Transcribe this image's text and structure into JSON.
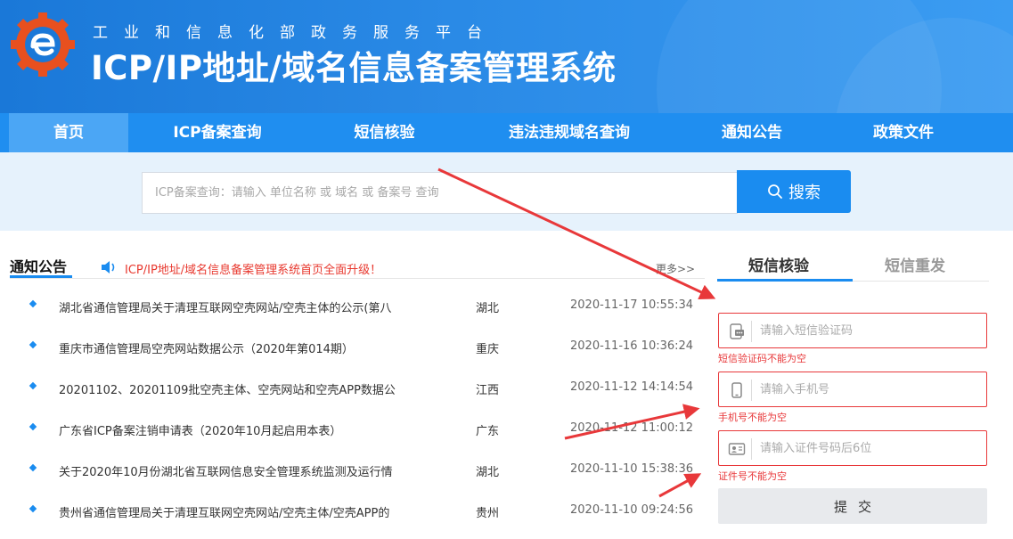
{
  "header": {
    "org": "工业和信息化部政务服务平台",
    "title": "ICP/IP地址/域名信息备案管理系统"
  },
  "nav": [
    {
      "label": "首页",
      "active": true
    },
    {
      "label": "ICP备案查询",
      "active": false
    },
    {
      "label": "短信核验",
      "active": false
    },
    {
      "label": "违法违规域名查询",
      "active": false
    },
    {
      "label": "通知公告",
      "active": false
    },
    {
      "label": "政策文件",
      "active": false
    }
  ],
  "search": {
    "placeholder": "ICP备案查询：请输入 单位名称 或 域名 或 备案号 查询",
    "button_label": "搜索"
  },
  "notice": {
    "heading": "通知公告",
    "scroll_text": "ICP/IP地址/域名信息备案管理系统首页全面升级！",
    "more_label": "更多>>",
    "items": [
      {
        "title": "湖北省通信管理局关于清理互联网空壳网站/空壳主体的公示(第八",
        "region": "湖北",
        "date": "2020-11-17 10:55:34"
      },
      {
        "title": "重庆市通信管理局空壳网站数据公示（2020年第014期）",
        "region": "重庆",
        "date": "2020-11-16 10:36:24"
      },
      {
        "title": "20201102、20201109批空壳主体、空壳网站和空壳APP数据公",
        "region": "江西",
        "date": "2020-11-12 14:14:54"
      },
      {
        "title": "广东省ICP备案注销申请表（2020年10月起启用本表）",
        "region": "广东",
        "date": "2020-11-12 11:00:12"
      },
      {
        "title": "关于2020年10月份湖北省互联网信息安全管理系统监测及运行情",
        "region": "湖北",
        "date": "2020-11-10 15:38:36"
      },
      {
        "title": "贵州省通信管理局关于清理互联网空壳网站/空壳主体/空壳APP的",
        "region": "贵州",
        "date": "2020-11-10 09:24:56"
      }
    ]
  },
  "sms": {
    "tab_verify": "短信核验",
    "tab_resend": "短信重发",
    "fields": [
      {
        "placeholder": "请输入短信验证码",
        "error": "短信验证码不能为空",
        "icon": "sms-icon"
      },
      {
        "placeholder": "请输入手机号",
        "error": "手机号不能为空",
        "icon": "phone-icon"
      },
      {
        "placeholder": "请输入证件号码后6位",
        "error": "证件号不能为空",
        "icon": "id-card-icon"
      }
    ],
    "submit_label": "提交"
  },
  "colors": {
    "primary": "#1a8cf0",
    "error": "#e8383a",
    "annotation_arrow": "#e8383a"
  }
}
